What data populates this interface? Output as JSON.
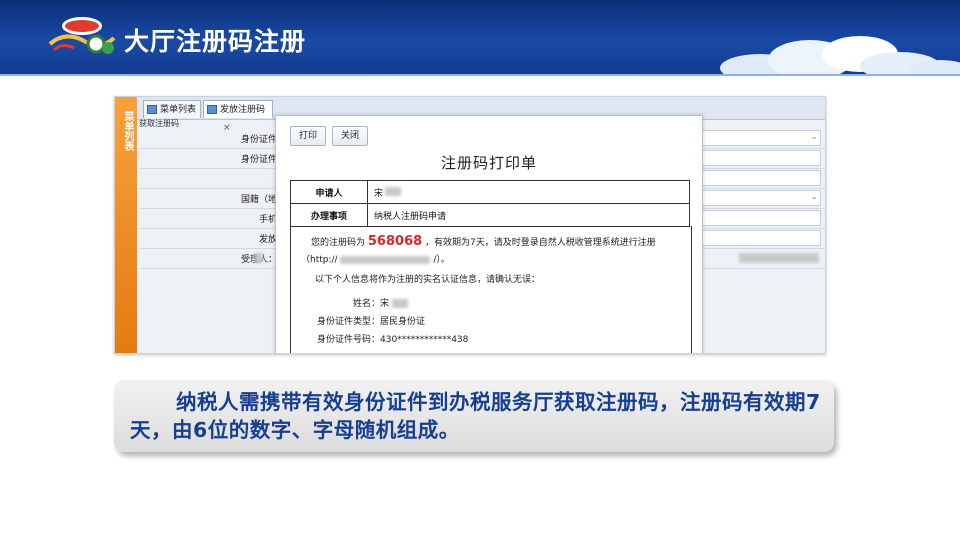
{
  "slide": {
    "title": "大厅注册码注册",
    "caption": "纳税人需携带有效身份证件到办税服务厅获取注册码，注册码有效期7天，由6位的数字、字母随机组成。"
  },
  "app": {
    "side_tab": "菜单列表",
    "tabs": [
      {
        "label": "菜单列表",
        "closable": false
      },
      {
        "label": "发放注册码",
        "closable": true,
        "close_symbol": "×"
      }
    ],
    "section_header": "获取注册码",
    "form_rows": [
      {
        "label": "身份证件",
        "has_dropdown": true
      },
      {
        "label": "身份证件",
        "has_dropdown": false
      },
      {
        "label": "",
        "has_dropdown": false
      },
      {
        "label": "国籍（地",
        "has_dropdown": true
      },
      {
        "label": "手机",
        "has_dropdown": false
      },
      {
        "label": "发放",
        "has_dropdown": false
      },
      {
        "label": "受理人：",
        "has_dropdown": false
      }
    ]
  },
  "dialog": {
    "buttons": {
      "print": "打印",
      "close": "关闭"
    },
    "title": "注册码打印单",
    "table": [
      {
        "key": "申请人",
        "value": "宋"
      },
      {
        "key": "办理事项",
        "value": "纳税人注册码申请"
      }
    ],
    "body": {
      "code_prefix": "您的注册码为",
      "code": "568068",
      "code_suffix": "，有效期为7天，请及时登录自然人税收管理系统进行注册",
      "url_prefix": "（http://",
      "url_suffix": "/）。",
      "confirm_text": "以下个人信息将作为注册的实名认证信息，请确认无误：",
      "name_label": "姓名：宋",
      "id_type_label": "身份证件类型：",
      "id_type_value": "居民身份证",
      "id_no_label": "身份证件号码：",
      "id_no_value": "430************438"
    }
  },
  "colors": {
    "banner": "#1a4aa6",
    "caption_text": "#163f8f",
    "code": "#d6262b",
    "side_tab": "#f39a2e"
  }
}
